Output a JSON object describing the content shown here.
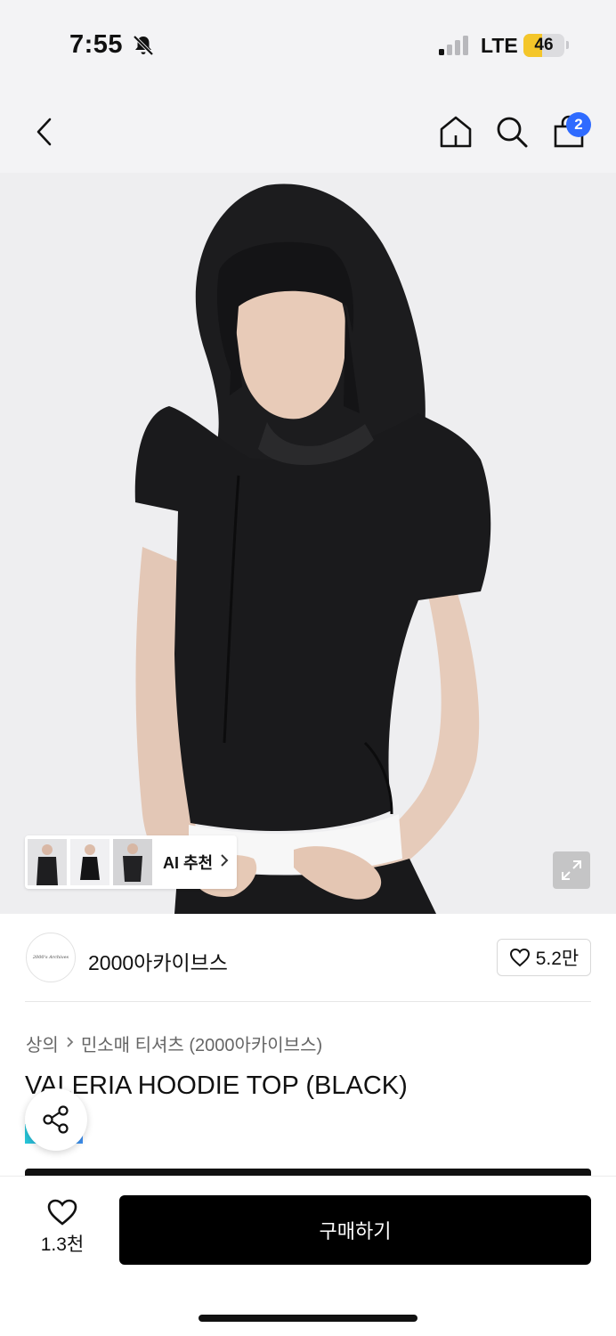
{
  "status_bar": {
    "time": "7:55",
    "network": "LTE",
    "battery": "46",
    "battery_level": 0.46,
    "icons": [
      "bell-off-icon",
      "signal-icon",
      "battery-icon"
    ]
  },
  "nav": {
    "icons": [
      "back-arrow-icon",
      "home-icon",
      "search-icon",
      "shopping-bag-icon"
    ],
    "cart_count": "2",
    "badge_color": "#2f6bff"
  },
  "gallery": {
    "ai_recommend_label": "AI 추천",
    "ai_thumbnail_count": 3,
    "icons": [
      "chevron-right-icon",
      "expand-icon"
    ]
  },
  "brand": {
    "logo_text": "2000's Archives",
    "name": "2000아카이브스",
    "likes": "5.2만",
    "icons": [
      "heart-outline-icon"
    ]
  },
  "breadcrumb": {
    "category": "상의",
    "subcategory": "민소매 티셔츠 (2000아카이브스)"
  },
  "product": {
    "title": "VALERIA HOODIE TOP (BLACK)",
    "share_icon": "share-icon"
  },
  "bottom_bar": {
    "wish_count": "1.3천",
    "buy_label": "구매하기",
    "icons": [
      "heart-outline-icon"
    ]
  }
}
